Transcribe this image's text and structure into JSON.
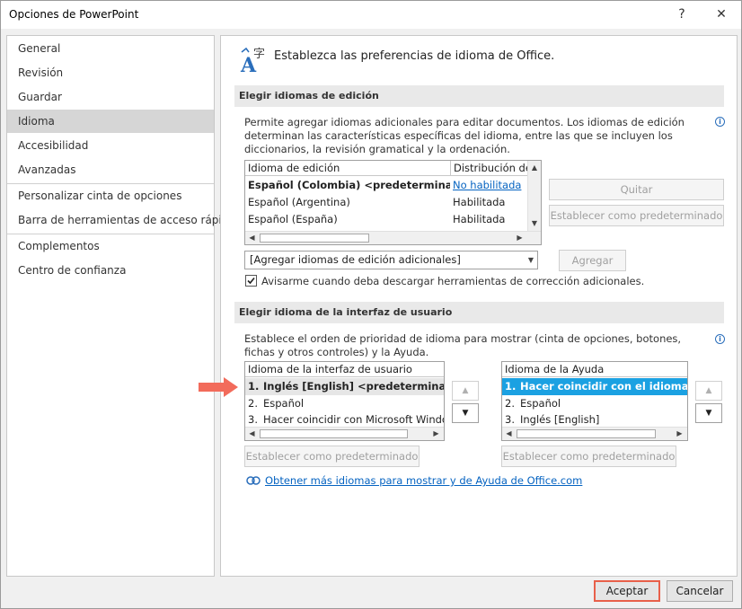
{
  "window": {
    "title": "Opciones de PowerPoint",
    "help_glyph": "?",
    "close_glyph": "✕"
  },
  "sidebar": {
    "items": [
      {
        "label": "General"
      },
      {
        "label": "Revisión"
      },
      {
        "label": "Guardar"
      },
      {
        "label": "Idioma"
      },
      {
        "label": "Accesibilidad"
      },
      {
        "label": "Avanzadas"
      },
      {
        "label": "Personalizar cinta de opciones"
      },
      {
        "label": "Barra de herramientas de acceso rápido"
      },
      {
        "label": "Complementos"
      },
      {
        "label": "Centro de confianza"
      }
    ],
    "selected": "Idioma"
  },
  "main": {
    "header": "Establezca las preferencias de idioma de Office.",
    "icon_glyph": "A字",
    "editing": {
      "section_title": "Elegir idiomas de edición",
      "description": "Permite agregar idiomas adicionales para editar documentos. Los idiomas de edición determinan las características específicas del idioma, entre las que se incluyen los diccionarios, la revisión gramatical y la ordenación.",
      "columns": [
        "Idioma de edición",
        "Distribución de"
      ],
      "rows": [
        {
          "language": "Español (Colombia) <predeterminado>",
          "status": "No habilitada"
        },
        {
          "language": "Español (Argentina)",
          "status": "Habilitada"
        },
        {
          "language": "Español (España)",
          "status": "Habilitada"
        }
      ],
      "remove_label": "Quitar",
      "set_default_label": "Establecer como predeterminado",
      "add_combo_value": "[Agregar idiomas de edición adicionales]",
      "add_label": "Agregar",
      "notify_checkbox_label": "Avisarme cuando deba descargar herramientas de corrección adicionales.",
      "notify_checked": true
    },
    "ui_language": {
      "section_title": "Elegir idioma de la interfaz de usuario",
      "description": "Establece el orden de prioridad de idioma para mostrar (cinta de opciones, botones, fichas y otros controles) y la Ayuda.",
      "display_list": {
        "header": "Idioma de la interfaz de usuario",
        "rows": [
          {
            "num": "1.",
            "label": "Inglés [English] <predeterminado>"
          },
          {
            "num": "2.",
            "label": "Español"
          },
          {
            "num": "3.",
            "label": "Hacer coincidir con Microsoft Windows"
          }
        ]
      },
      "help_list": {
        "header": "Idioma de la Ayuda",
        "rows": [
          {
            "num": "1.",
            "label": "Hacer coincidir con el idioma de la interfaz"
          },
          {
            "num": "2.",
            "label": "Español"
          },
          {
            "num": "3.",
            "label": "Inglés [English]"
          }
        ]
      },
      "set_default_label": "Establecer como predeterminado",
      "more_languages_link": "Obtener más idiomas para mostrar y de Ayuda de Office.com"
    }
  },
  "footer": {
    "ok_label": "Aceptar",
    "cancel_label": "Cancelar"
  },
  "colors": {
    "accent": "#1ba1e2",
    "highlight_border": "#e8604a",
    "link": "#0563c1"
  }
}
